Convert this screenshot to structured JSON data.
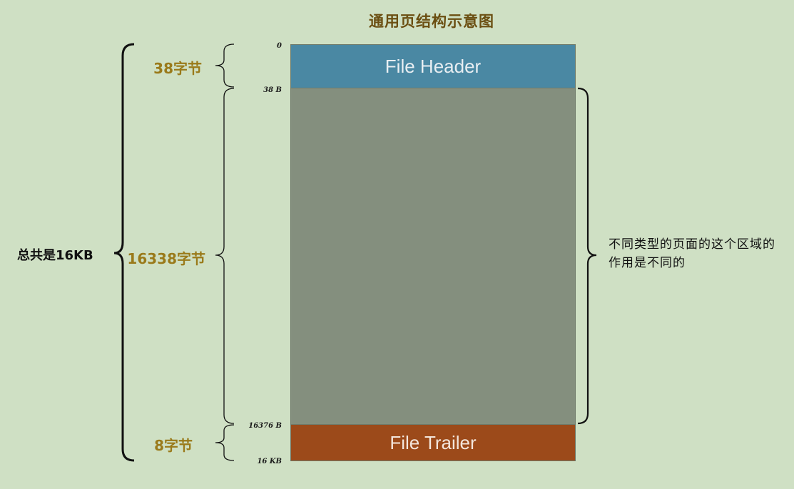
{
  "title": "通用页结构示意图",
  "blocks": {
    "header": "File Header",
    "body": "",
    "trailer": "File Trailer"
  },
  "offsets": {
    "start": "0",
    "header_end": "38 B",
    "trailer_start": "16376 B",
    "end": "16 KB"
  },
  "sizes": {
    "header": "38字节",
    "body": "16338字节",
    "trailer": "8字节",
    "total": "总共是16KB"
  },
  "note": "不同类型的页面的这个区域的作用是不同的",
  "colors": {
    "background": "#cfe0c4",
    "header": "#4a88a3",
    "body": "#848f7e",
    "trailer": "#9c4a1a",
    "title": "#6b4f12",
    "size_label": "#9a7a1a"
  }
}
